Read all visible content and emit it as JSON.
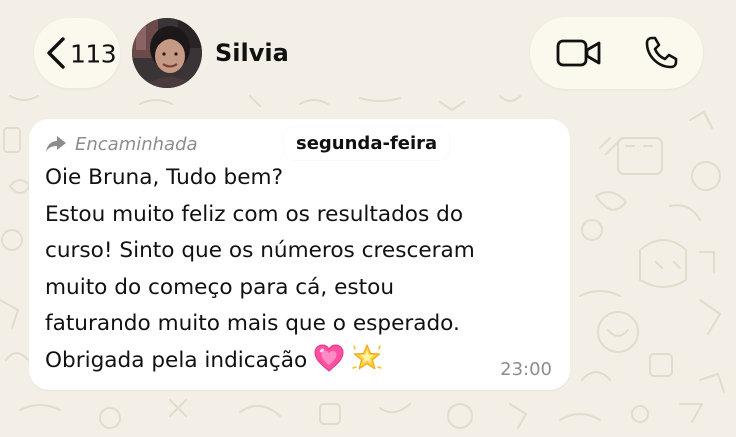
{
  "header": {
    "unread_count": "113",
    "contact_name": "Silvia",
    "avatar_icon": "contact-photo",
    "video_icon": "video-camera-icon",
    "phone_icon": "phone-icon"
  },
  "date_separator": "segunda-feira",
  "message": {
    "forwarded_label": "Encaminhada",
    "lines": [
      "Oie Bruna, Tudo bem?",
      "Estou muito feliz com os resultados do",
      "curso! Sinto que os números cresceram",
      "muito do começo para cá, estou",
      "faturando muito mais que o esperado.",
      "Obrigada pela indicação"
    ],
    "emojis": [
      "growing-heart-emoji",
      "glowing-star-emoji"
    ],
    "time": "23:00"
  },
  "colors": {
    "background": "#f3efe6",
    "bubble": "#ffffff",
    "pill": "#fbf8ee",
    "muted_text": "#8d8d8d"
  }
}
